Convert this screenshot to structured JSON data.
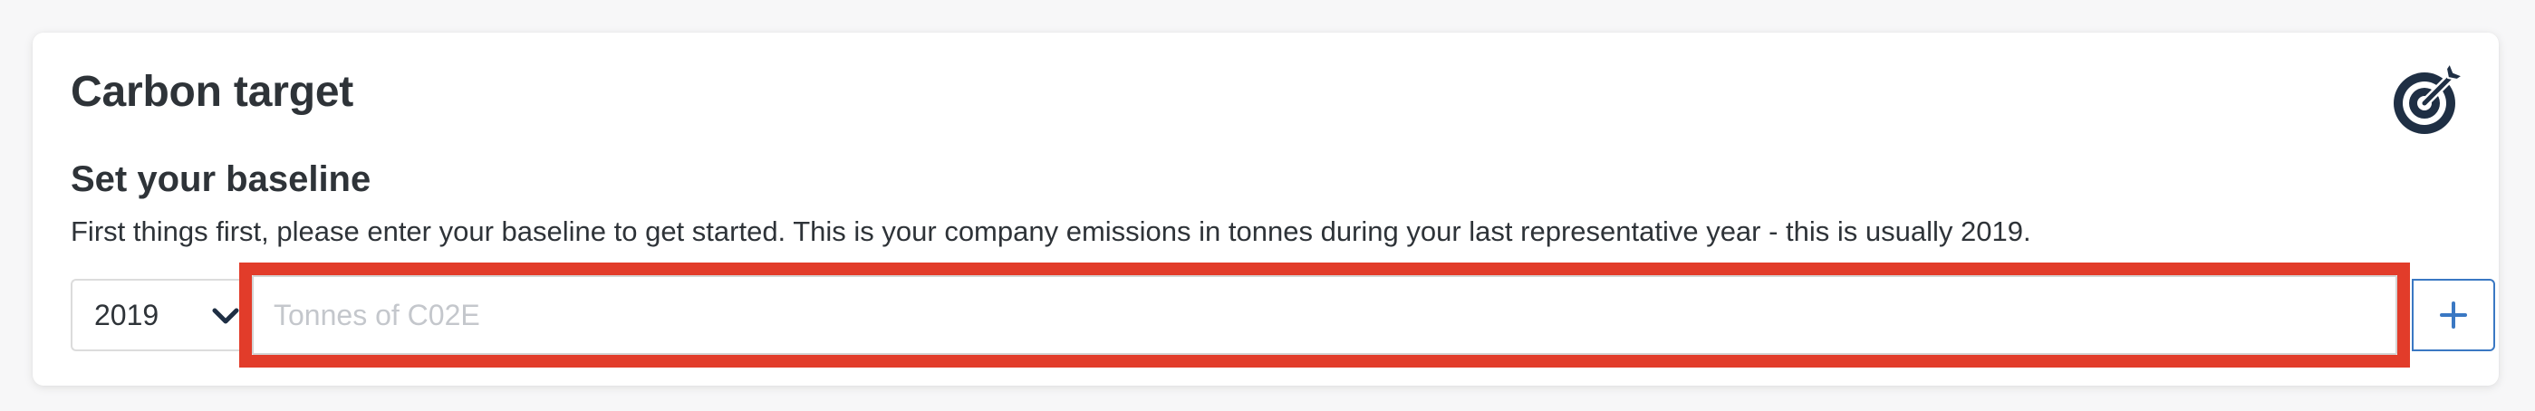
{
  "card": {
    "title": "Carbon target",
    "icon": "target-arrow-icon"
  },
  "baseline": {
    "heading": "Set your baseline",
    "description": "First things first, please enter your baseline to get started. This is your company emissions in tonnes during your last representative year - this is usually 2019.",
    "year_select": {
      "value": "2019",
      "icon": "chevron-down-icon"
    },
    "tonnes_input": {
      "value": "",
      "placeholder": "Tonnes of C02E"
    },
    "add_button": {
      "icon": "plus-icon"
    }
  },
  "colors": {
    "text": "#2e3338",
    "icon_navy": "#1f2f44",
    "accent_blue": "#3a78c3",
    "highlight_red": "#e23c2a",
    "placeholder": "#c4c7cc"
  }
}
